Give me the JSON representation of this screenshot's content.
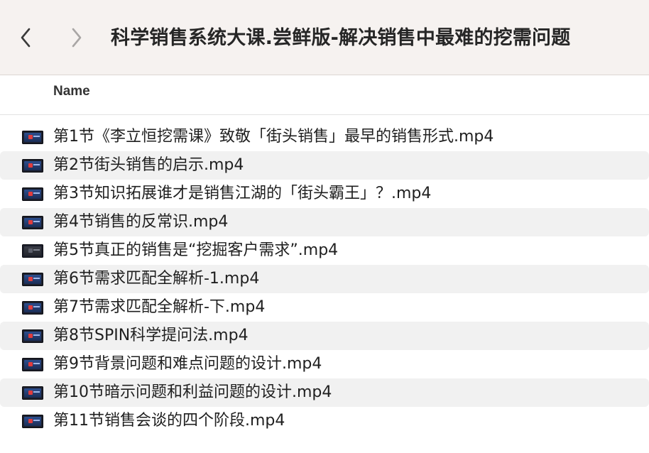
{
  "window": {
    "title": "科学销售系统大课.尝鲜版-解决销售中最难的挖需问题"
  },
  "navigation": {
    "back_icon": "chevron-left-icon",
    "forward_icon": "chevron-right-icon"
  },
  "columns": {
    "name": "Name"
  },
  "files": [
    {
      "name": "第1节《李立恒挖需课》致敬「街头销售」最早的销售形式.mp4",
      "icon": "video-file-icon"
    },
    {
      "name": "第2节街头销售的启示.mp4",
      "icon": "video-file-icon"
    },
    {
      "name": "第3节知识拓展谁才是销售江湖的「街头霸王」？.mp4",
      "icon": "video-file-icon"
    },
    {
      "name": "第4节销售的反常识.mp4",
      "icon": "video-file-icon"
    },
    {
      "name": "第5节真正的销售是“挖掘客户需求”.mp4",
      "icon": "video-file-icon"
    },
    {
      "name": "第6节需求匹配全解析-1.mp4",
      "icon": "video-file-icon"
    },
    {
      "name": "第7节需求匹配全解析-下.mp4",
      "icon": "video-file-icon"
    },
    {
      "name": "第8节SPIN科学提问法.mp4",
      "icon": "video-file-icon"
    },
    {
      "name": "第9节背景问题和难点问题的设计.mp4",
      "icon": "video-file-icon"
    },
    {
      "name": "第10节暗示问题和利益问题的设计.mp4",
      "icon": "video-file-icon"
    },
    {
      "name": "第11节销售会谈的四个阶段.mp4",
      "icon": "video-file-icon"
    }
  ]
}
